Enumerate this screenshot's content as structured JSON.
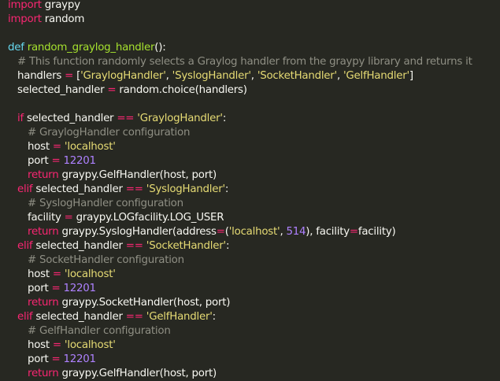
{
  "editor": {
    "lines": [
      [
        {
          "t": "kw",
          "v": "import"
        },
        {
          "t": "tx",
          "v": " graypy"
        }
      ],
      [
        {
          "t": "kw",
          "v": "import"
        },
        {
          "t": "tx",
          "v": " random"
        }
      ],
      [],
      [
        {
          "t": "df",
          "v": "def"
        },
        {
          "t": "tx",
          "v": " "
        },
        {
          "t": "fn",
          "v": "random_graylog_handler"
        },
        {
          "t": "tx",
          "v": "():"
        }
      ],
      [
        {
          "t": "cm",
          "v": "# This function randomly selects a Graylog handler from the graypy library and returns it"
        }
      ],
      [
        {
          "t": "tx",
          "v": "handlers "
        },
        {
          "t": "op",
          "v": "="
        },
        {
          "t": "tx",
          "v": " ["
        },
        {
          "t": "str",
          "v": "'GraylogHandler'"
        },
        {
          "t": "tx",
          "v": ", "
        },
        {
          "t": "str",
          "v": "'SyslogHandler'"
        },
        {
          "t": "tx",
          "v": ", "
        },
        {
          "t": "str",
          "v": "'SocketHandler'"
        },
        {
          "t": "tx",
          "v": ", "
        },
        {
          "t": "str",
          "v": "'GelfHandler'"
        },
        {
          "t": "tx",
          "v": "]"
        }
      ],
      [
        {
          "t": "tx",
          "v": "selected_handler "
        },
        {
          "t": "op",
          "v": "="
        },
        {
          "t": "tx",
          "v": " random.choice(handlers)"
        }
      ],
      [],
      [
        {
          "t": "kw",
          "v": "if"
        },
        {
          "t": "tx",
          "v": " selected_handler "
        },
        {
          "t": "op",
          "v": "=="
        },
        {
          "t": "tx",
          "v": " "
        },
        {
          "t": "str",
          "v": "'GraylogHandler'"
        },
        {
          "t": "tx",
          "v": ":"
        }
      ],
      [
        {
          "t": "cm",
          "v": "# GraylogHandler configuration"
        }
      ],
      [
        {
          "t": "tx",
          "v": "host "
        },
        {
          "t": "op",
          "v": "="
        },
        {
          "t": "tx",
          "v": " "
        },
        {
          "t": "str",
          "v": "'localhost'"
        }
      ],
      [
        {
          "t": "tx",
          "v": "port "
        },
        {
          "t": "op",
          "v": "="
        },
        {
          "t": "tx",
          "v": " "
        },
        {
          "t": "num",
          "v": "12201"
        }
      ],
      [
        {
          "t": "kw",
          "v": "return"
        },
        {
          "t": "tx",
          "v": " graypy.GelfHandler(host, port)"
        }
      ],
      [
        {
          "t": "kw",
          "v": "elif"
        },
        {
          "t": "tx",
          "v": " selected_handler "
        },
        {
          "t": "op",
          "v": "=="
        },
        {
          "t": "tx",
          "v": " "
        },
        {
          "t": "str",
          "v": "'SyslogHandler'"
        },
        {
          "t": "tx",
          "v": ":"
        }
      ],
      [
        {
          "t": "cm",
          "v": "# SyslogHandler configuration"
        }
      ],
      [
        {
          "t": "tx",
          "v": "facility "
        },
        {
          "t": "op",
          "v": "="
        },
        {
          "t": "tx",
          "v": " graypy.LOGfacility.LOG_USER"
        }
      ],
      [
        {
          "t": "kw",
          "v": "return"
        },
        {
          "t": "tx",
          "v": " graypy.SyslogHandler(address"
        },
        {
          "t": "op",
          "v": "="
        },
        {
          "t": "tx",
          "v": "("
        },
        {
          "t": "str",
          "v": "'localhost'"
        },
        {
          "t": "tx",
          "v": ", "
        },
        {
          "t": "num",
          "v": "514"
        },
        {
          "t": "tx",
          "v": "), facility"
        },
        {
          "t": "op",
          "v": "="
        },
        {
          "t": "tx",
          "v": "facility)"
        }
      ],
      [
        {
          "t": "kw",
          "v": "elif"
        },
        {
          "t": "tx",
          "v": " selected_handler "
        },
        {
          "t": "op",
          "v": "=="
        },
        {
          "t": "tx",
          "v": " "
        },
        {
          "t": "str",
          "v": "'SocketHandler'"
        },
        {
          "t": "tx",
          "v": ":"
        }
      ],
      [
        {
          "t": "cm",
          "v": "# SocketHandler configuration"
        }
      ],
      [
        {
          "t": "tx",
          "v": "host "
        },
        {
          "t": "op",
          "v": "="
        },
        {
          "t": "tx",
          "v": " "
        },
        {
          "t": "str",
          "v": "'localhost'"
        }
      ],
      [
        {
          "t": "tx",
          "v": "port "
        },
        {
          "t": "op",
          "v": "="
        },
        {
          "t": "tx",
          "v": " "
        },
        {
          "t": "num",
          "v": "12201"
        }
      ],
      [
        {
          "t": "kw",
          "v": "return"
        },
        {
          "t": "tx",
          "v": " graypy.SocketHandler(host, port)"
        }
      ],
      [
        {
          "t": "kw",
          "v": "elif"
        },
        {
          "t": "tx",
          "v": " selected_handler "
        },
        {
          "t": "op",
          "v": "=="
        },
        {
          "t": "tx",
          "v": " "
        },
        {
          "t": "str",
          "v": "'GelfHandler'"
        },
        {
          "t": "tx",
          "v": ":"
        }
      ],
      [
        {
          "t": "cm",
          "v": "# GelfHandler configuration"
        }
      ],
      [
        {
          "t": "tx",
          "v": "host "
        },
        {
          "t": "op",
          "v": "="
        },
        {
          "t": "tx",
          "v": " "
        },
        {
          "t": "str",
          "v": "'localhost'"
        }
      ],
      [
        {
          "t": "tx",
          "v": "port "
        },
        {
          "t": "op",
          "v": "="
        },
        {
          "t": "tx",
          "v": " "
        },
        {
          "t": "num",
          "v": "12201"
        }
      ],
      [
        {
          "t": "kw",
          "v": "return"
        },
        {
          "t": "tx",
          "v": " graypy.GelfHandler(host, port)"
        }
      ]
    ]
  }
}
